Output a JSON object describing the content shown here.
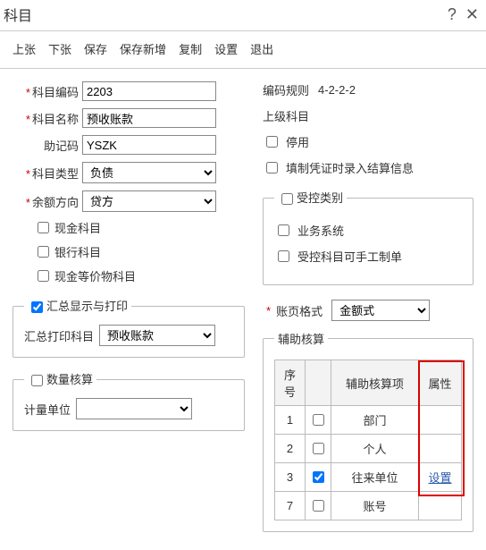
{
  "window": {
    "title": "科目"
  },
  "toolbar": {
    "prev": "上张",
    "next": "下张",
    "save": "保存",
    "save_new": "保存新增",
    "copy": "复制",
    "settings": "设置",
    "exit": "退出"
  },
  "left": {
    "code_label": "科目编码",
    "code_value": "2203",
    "name_label": "科目名称",
    "name_value": "预收账款",
    "mnemonic_label": "助记码",
    "mnemonic_value": "YSZK",
    "type_label": "科目类型",
    "type_value": "负债",
    "balance_dir_label": "余额方向",
    "balance_dir_value": "贷方",
    "cb_cash": "现金科目",
    "cb_bank": "银行科目",
    "cb_cash_equiv": "现金等价物科目",
    "summary_legend": "汇总显示与打印",
    "summary_print_label": "汇总打印科目",
    "summary_print_value": "预收账款",
    "qty_legend": "数量核算",
    "qty_unit_label": "计量单位"
  },
  "right": {
    "encode_rule_label": "编码规则",
    "encode_rule_value": "4-2-2-2",
    "parent_label": "上级科目",
    "cb_disable": "停用",
    "cb_fill_settle": "填制凭证时录入结算信息",
    "controlled_legend": "受控类别",
    "cb_biz": "业务系统",
    "cb_manual": "受控科目可手工制单",
    "page_format_label": "账页格式",
    "page_format_value": "金额式",
    "aux_legend": "辅助核算",
    "aux_cols": {
      "seq": "序号",
      "chk": "",
      "item": "辅助核算项",
      "attr": "属性"
    },
    "aux_rows": [
      {
        "seq": "1",
        "checked": false,
        "item": "部门",
        "attr": ""
      },
      {
        "seq": "2",
        "checked": false,
        "item": "个人",
        "attr": ""
      },
      {
        "seq": "3",
        "checked": true,
        "item": "往来单位",
        "attr": "设置"
      },
      {
        "seq": "7",
        "checked": false,
        "item": "账号",
        "attr": ""
      }
    ]
  }
}
